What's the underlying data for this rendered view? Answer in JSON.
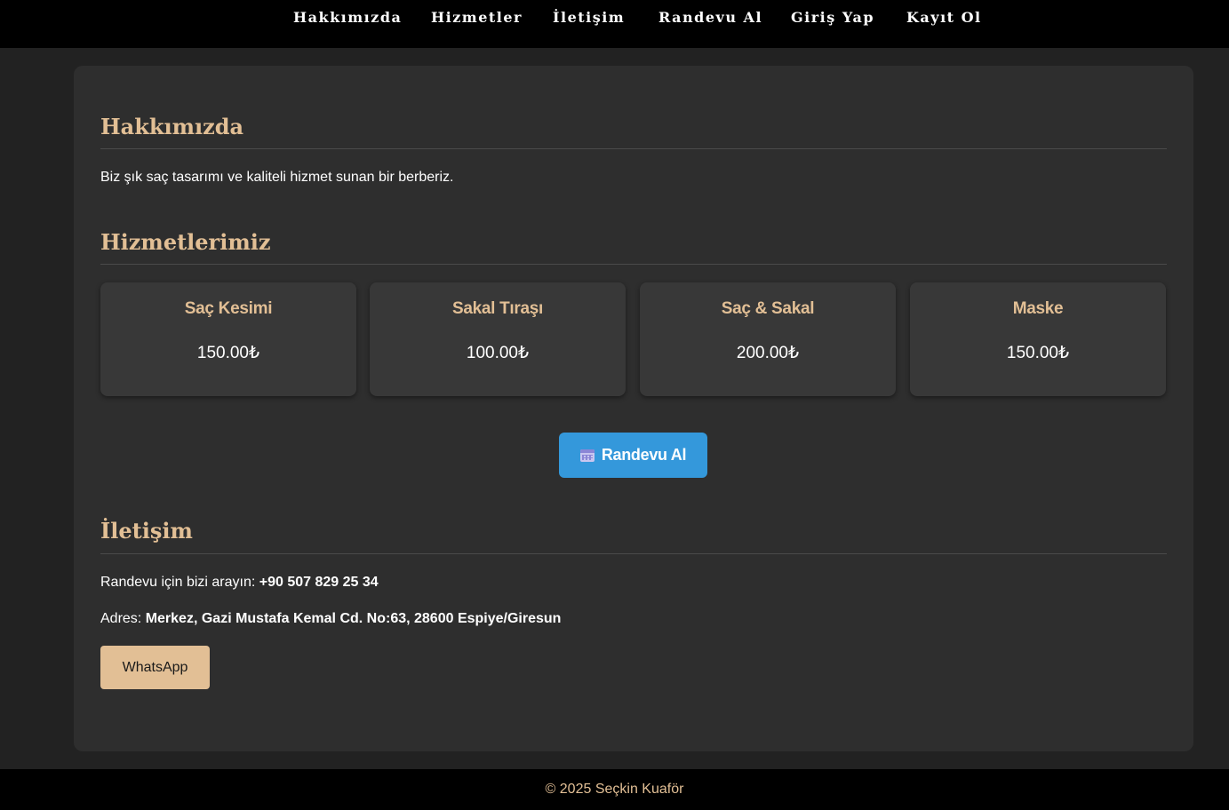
{
  "nav": {
    "items": [
      {
        "label": "Hakkımızda"
      },
      {
        "label": "Hizmetler"
      },
      {
        "label": "İletişim"
      },
      {
        "label": "Randevu Al"
      },
      {
        "label": "Giriş Yap"
      },
      {
        "label": "Kayıt Ol"
      }
    ]
  },
  "about": {
    "title": "Hakkımızda",
    "text": "Biz şık saç tasarımı ve kaliteli hizmet sunan bir berberiz."
  },
  "services": {
    "title": "Hizmetlerimiz",
    "items": [
      {
        "name": "Saç Kesimi",
        "price": "150.00₺"
      },
      {
        "name": "Sakal Tıraşı",
        "price": "100.00₺"
      },
      {
        "name": "Saç & Sakal",
        "price": "200.00₺"
      },
      {
        "name": "Maske",
        "price": "150.00₺"
      }
    ],
    "appointment_button": "Randevu Al",
    "appointment_icon": "calendar-icon"
  },
  "contact": {
    "title": "İletişim",
    "phone_label": "Randevu için bizi arayın:",
    "phone": "+90 507 829 25 34",
    "address_label": "Adres:",
    "address": "Merkez, Gazi Mustafa Kemal Cd. No:63, 28600 Espiye/Giresun",
    "whatsapp_button": "WhatsApp"
  },
  "footer": {
    "text": "© 2025 Seçkin Kuaför"
  },
  "colors": {
    "accent": "#e2bf95",
    "button_blue": "#3498db",
    "nav_bg": "#000000",
    "page_bg": "#222222",
    "card_bg": "#2e2e2e"
  }
}
